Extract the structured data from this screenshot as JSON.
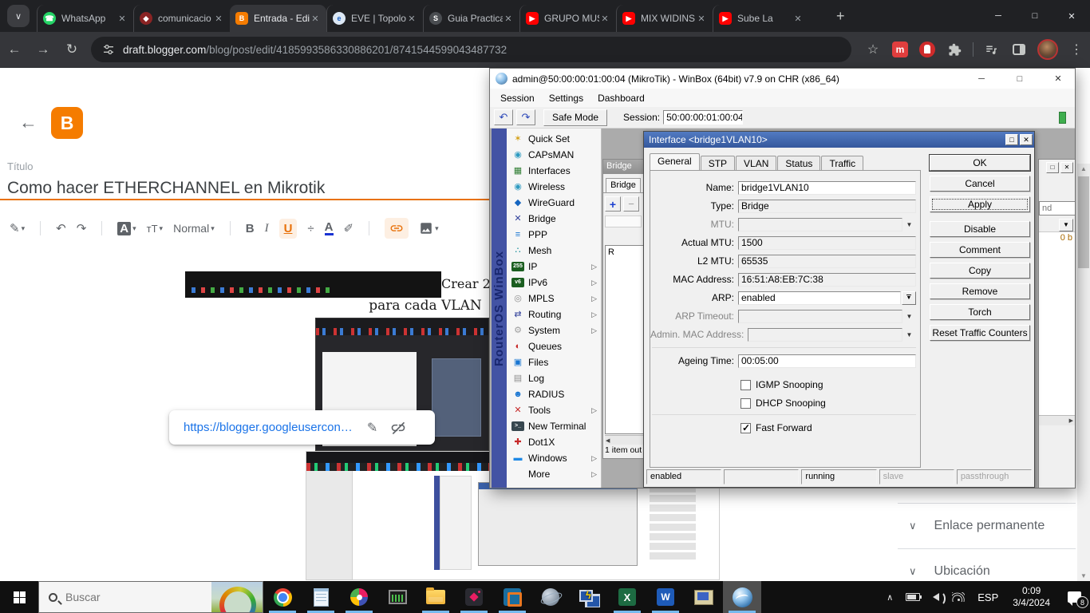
{
  "icons": {
    "tab_search": "∨",
    "new_tab": "+",
    "minimize": "─",
    "maximize": "□",
    "close": "✕",
    "back": "←",
    "forward": "→",
    "reload": "↻",
    "bookmark": "☆",
    "more_vert": "⋮",
    "undo": "↶",
    "redo": "↷",
    "caret_down": "▾",
    "bold": "B",
    "italic": "I",
    "underline": "U",
    "strikethrough": "÷",
    "text_color": "A",
    "highlight_pen": "✐",
    "pencil": "✎",
    "dropdown": "▼",
    "submenu": "▷",
    "plus": "+",
    "minus": "−",
    "scroll_up": "▲",
    "scroll_down": "▼",
    "scroll_left": "◀",
    "scroll_right": "▶",
    "chevron_up": "∧",
    "chevron_down": "∨",
    "audio": "◄)))"
  },
  "browser": {
    "tabs": [
      {
        "label": "WhatsApp",
        "shape": "fav-circle",
        "fav_bg": "#25d366",
        "fav_glyph": "☎"
      },
      {
        "label": "comunicacio",
        "shape": "fav-circle",
        "fav_bg": "#8a2424",
        "fav_glyph": "◆"
      },
      {
        "label": "Entrada - Edi",
        "shape": "fav-round",
        "fav_bg": "#f57c00",
        "fav_glyph": "B",
        "active": true
      },
      {
        "label": "EVE | Topolo",
        "shape": "fav-circle",
        "fav_bg": "#dce8f5",
        "fav_fg": "#1c62c5",
        "fav_glyph": "e"
      },
      {
        "label": "Guia Practica",
        "shape": "fav-circle",
        "fav_bg": "#4a4d51",
        "fav_glyph": "S"
      },
      {
        "label": "GRUPO MUS",
        "shape": "fav-round",
        "fav_bg": "#ff0000",
        "fav_glyph": "▶"
      },
      {
        "label": "MIX WIDINS",
        "shape": "fav-round",
        "fav_bg": "#ff0000",
        "fav_glyph": "▶"
      },
      {
        "label": "Sube La",
        "shape": "fav-round",
        "fav_bg": "#ff0000",
        "fav_glyph": "▶",
        "audio": true
      }
    ],
    "url_host": "draft.blogger.com",
    "url_path": "/blog/post/edit/4185993586330886201/8741544599043487732"
  },
  "blogger": {
    "titulo_label": "Título",
    "title_value": "Como hacer ETHERCHANNEL en Mikrotik",
    "paragraph_style": "Normal",
    "caption_top": "Crear 2",
    "caption_bottom": "para cada VLAN",
    "link_popup_url": "https://blogger.googleusercon…",
    "sidebar_items": [
      "Enlace permanente",
      "Ubicación"
    ]
  },
  "winbox": {
    "title": "admin@50:00:00:01:00:04 (MikroTik) - WinBox (64bit) v7.9 on CHR (x86_64)",
    "menubar": [
      "Session",
      "Settings",
      "Dashboard"
    ],
    "safe_mode": "Safe Mode",
    "session_label": "Session:",
    "session_value": "50:00:00:01:00:04",
    "brand_vertical": "RouterOS WinBox",
    "nav": [
      {
        "label": "Quick Set",
        "glyph": "✶",
        "color": "#d4a017"
      },
      {
        "label": "CAPsMAN",
        "glyph": "◉",
        "color": "#2f9bc1"
      },
      {
        "label": "Interfaces",
        "glyph": "▦",
        "color": "#2e7d32"
      },
      {
        "label": "Wireless",
        "glyph": "◉",
        "color": "#2f9bc1"
      },
      {
        "label": "WireGuard",
        "glyph": "◆",
        "color": "#1565c0"
      },
      {
        "label": "Bridge",
        "glyph": "✕",
        "color": "#30409a"
      },
      {
        "label": "PPP",
        "glyph": "≡",
        "color": "#1976d2"
      },
      {
        "label": "Mesh",
        "glyph": "∴",
        "color": "#00838f"
      },
      {
        "label": "IP",
        "glyph": "255",
        "chip": true,
        "bg": "#1b5e20",
        "color": "#fff",
        "arrow": true
      },
      {
        "label": "IPv6",
        "glyph": "v6",
        "chip": true,
        "bg": "#1b5e20",
        "color": "#fff",
        "arrow": true
      },
      {
        "label": "MPLS",
        "glyph": "◎",
        "color": "#8d8d8d",
        "arrow": true
      },
      {
        "label": "Routing",
        "glyph": "⇄",
        "color": "#30409a",
        "arrow": true
      },
      {
        "label": "System",
        "glyph": "⚙",
        "color": "#9e9e9e",
        "arrow": true
      },
      {
        "label": "Queues",
        "glyph": "◐",
        "color": "#c62828"
      },
      {
        "label": "Files",
        "glyph": "▣",
        "color": "#1976d2"
      },
      {
        "label": "Log",
        "glyph": "▤",
        "color": "#8d8d8d"
      },
      {
        "label": "RADIUS",
        "glyph": "☻",
        "color": "#1976d2"
      },
      {
        "label": "Tools",
        "glyph": "✕",
        "color": "#c62828",
        "arrow": true
      },
      {
        "label": "New Terminal",
        "glyph": ">_",
        "chip": true,
        "bg": "#37474f",
        "color": "#fff"
      },
      {
        "label": "Dot1X",
        "glyph": "✚",
        "color": "#c62828"
      },
      {
        "label": "Windows",
        "glyph": "▬",
        "color": "#1e88e5",
        "arrow": true
      },
      {
        "label": "More",
        "glyph": "",
        "color": "",
        "arrow": true
      }
    ],
    "bridge_window": {
      "title": "Bridge",
      "tab": "Bridge",
      "row": "R",
      "status": "1 item out"
    },
    "right_window": {
      "find_fragment": "nd",
      "rate_fragment": "0 b"
    },
    "dialog": {
      "title": "Interface <bridge1VLAN10>",
      "tabs": [
        {
          "label": "General",
          "active": true
        },
        {
          "label": "STP"
        },
        {
          "label": "VLAN"
        },
        {
          "label": "Status"
        },
        {
          "label": "Traffic"
        }
      ],
      "fields": [
        {
          "label": "Name:",
          "value": "bridge1VLAN10",
          "arrow_class": "ar-none"
        },
        {
          "label": "Type:",
          "value": "Bridge",
          "ro": true,
          "arrow_class": "ar-none"
        },
        {
          "label": "MTU:",
          "value": "",
          "dim": true,
          "arrow_class": "ar-plain"
        },
        {
          "label": "Actual MTU:",
          "value": "1500",
          "ro": true,
          "arrow_class": "ar-none"
        },
        {
          "label": "L2 MTU:",
          "value": "65535",
          "ro": true,
          "arrow_class": "ar-none"
        },
        {
          "label": "MAC Address:",
          "value": "16:51:A8:EB:7C:38",
          "ro": true,
          "arrow_class": "ar-none"
        },
        {
          "label": "ARP:",
          "value": "enabled",
          "arrow_class": "ar-combo"
        },
        {
          "label": "ARP Timeout:",
          "value": "",
          "dim": true,
          "arrow_class": "ar-plain"
        },
        {
          "label": "Admin. MAC Address:",
          "value": "",
          "dim": true,
          "arrow_class": "ar-plain"
        },
        {
          "label": "Ageing Time:",
          "value": "00:05:00",
          "sep": true,
          "arrow_class": "ar-none"
        }
      ],
      "checkboxes": [
        {
          "label": "IGMP Snooping",
          "checked": false
        },
        {
          "label": "DHCP Snooping",
          "checked": false
        }
      ],
      "checkboxes2": [
        {
          "label": "Fast Forward",
          "checked": true
        }
      ],
      "buttons_top": [
        {
          "label": "OK",
          "default": true
        },
        {
          "label": "Cancel"
        },
        {
          "label": "Apply",
          "focused": true
        }
      ],
      "buttons_mid": [
        {
          "label": "Disable"
        },
        {
          "label": "Comment"
        },
        {
          "label": "Copy"
        },
        {
          "label": "Remove"
        },
        {
          "label": "Torch"
        },
        {
          "label": "Reset Traffic Counters"
        }
      ],
      "status_segments": [
        {
          "text": "enabled"
        },
        {
          "text": ""
        },
        {
          "text": "running"
        },
        {
          "text": "slave",
          "dim": true
        },
        {
          "text": "passthrough",
          "dim": true
        }
      ]
    }
  },
  "taskbar": {
    "search_placeholder": "Buscar",
    "language": "ESP",
    "time": "0:09",
    "date": "3/4/2024",
    "notification_count": "8",
    "apps": [
      {
        "name": "chrome",
        "icon": "ic-chrome",
        "active": true
      },
      {
        "name": "notepad",
        "icon": "ic-notepad",
        "active": true
      },
      {
        "name": "paint",
        "icon": "ic-paint",
        "active": true
      },
      {
        "name": "task-manager",
        "icon": "ic-taskmgr"
      },
      {
        "name": "file-explorer",
        "icon": "ic-explorer",
        "active": true
      },
      {
        "name": "pink-diamond-app",
        "icon": "ic-darkapp",
        "active": true
      },
      {
        "name": "vmware-workstation",
        "icon": "ic-vmware",
        "active": true
      },
      {
        "name": "eve-ng",
        "icon": "ic-atom"
      },
      {
        "name": "putty",
        "icon": "ic-putty"
      },
      {
        "name": "excel",
        "icon": "ic-excel",
        "active": true
      },
      {
        "name": "word",
        "icon": "ic-word",
        "active": true
      },
      {
        "name": "remote-desktop",
        "icon": "ic-remote"
      },
      {
        "name": "winbox",
        "icon": "ic-winbox",
        "active": true,
        "highlighted": true
      }
    ]
  }
}
